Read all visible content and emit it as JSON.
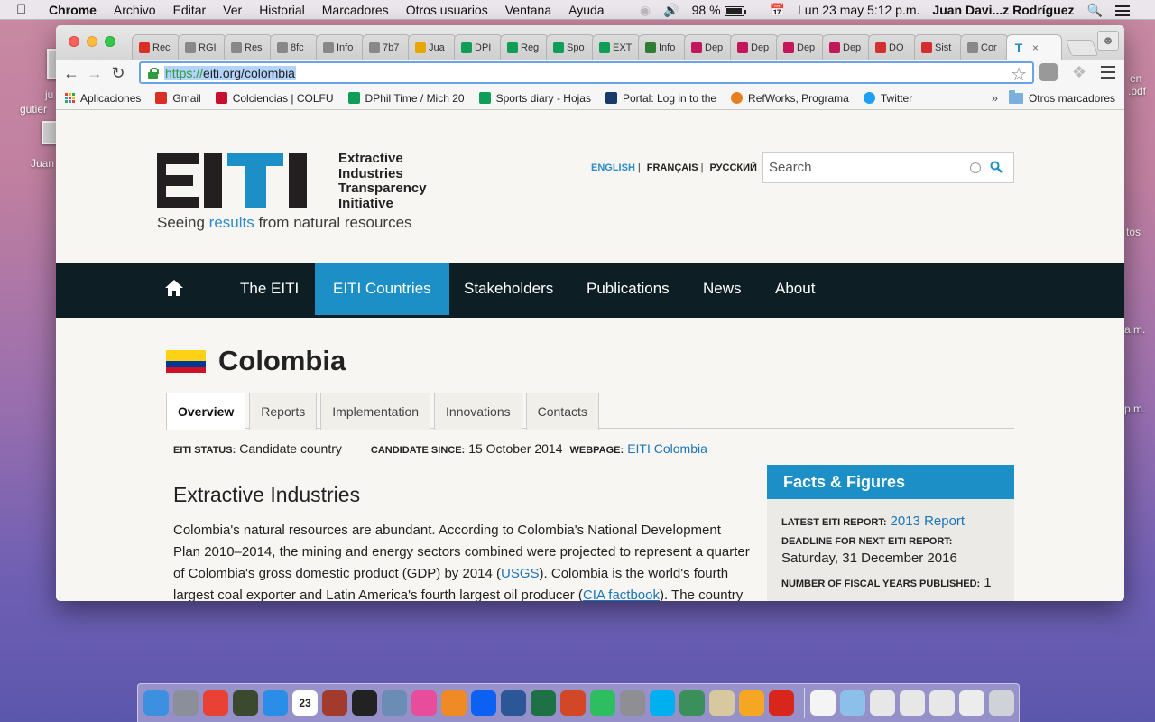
{
  "menubar": {
    "app": "Chrome",
    "items": [
      "Archivo",
      "Editar",
      "Ver",
      "Historial",
      "Marcadores",
      "Otros usuarios",
      "Ventana",
      "Ayuda"
    ],
    "battery": "98 %",
    "datetime": "Lun 23 may  5:12 p.m.",
    "user": "Juan Davi...z Rodríguez"
  },
  "desktop": {
    "labels": [
      "ju",
      "gutier",
      "Juan",
      "en",
      ".pdf",
      "tos",
      "a.m.",
      "p.m."
    ]
  },
  "browser": {
    "tabs": [
      {
        "label": "Rec",
        "icon": "gmail-icon",
        "color": "#d93025"
      },
      {
        "label": "RGI",
        "icon": "doc-icon",
        "color": "#888888"
      },
      {
        "label": "Res",
        "icon": "doc-icon",
        "color": "#888888"
      },
      {
        "label": "8fc",
        "icon": "doc-icon",
        "color": "#888888"
      },
      {
        "label": "Info",
        "icon": "doc-icon",
        "color": "#888888"
      },
      {
        "label": "7b7",
        "icon": "doc-icon",
        "color": "#888888"
      },
      {
        "label": "Jua",
        "icon": "outlook-icon",
        "color": "#e8a700"
      },
      {
        "label": "DPI",
        "icon": "sheets-icon",
        "color": "#0f9d58"
      },
      {
        "label": "Reg",
        "icon": "sheets-icon",
        "color": "#0f9d58"
      },
      {
        "label": "Spo",
        "icon": "sheets-icon",
        "color": "#0f9d58"
      },
      {
        "label": "EXT",
        "icon": "sheets-icon",
        "color": "#0f9d58"
      },
      {
        "label": "Info",
        "icon": "tree-icon",
        "color": "#2e7d32"
      },
      {
        "label": "Dep",
        "icon": "bank-icon",
        "color": "#c2185b"
      },
      {
        "label": "Dep",
        "icon": "bank-icon",
        "color": "#c2185b"
      },
      {
        "label": "Dep",
        "icon": "bank-icon",
        "color": "#c2185b"
      },
      {
        "label": "Dep",
        "icon": "bank-icon",
        "color": "#c2185b"
      },
      {
        "label": "DO",
        "icon": "red-dot-icon",
        "color": "#d32f2f"
      },
      {
        "label": "Sist",
        "icon": "red-dot-icon",
        "color": "#d32f2f"
      },
      {
        "label": "Cor",
        "icon": "doc-icon",
        "color": "#888888"
      }
    ],
    "active_tab": {
      "label": "T",
      "icon": "eiti-icon",
      "color": "#1b8fc6"
    },
    "url_scheme": "https://",
    "url_rest": "eiti.org/colombia",
    "bookmarks": [
      {
        "label": "Aplicaciones",
        "icon": "apps-icon"
      },
      {
        "label": "Gmail",
        "icon": "gmail-icon",
        "color": "#d93025"
      },
      {
        "label": "Colciencias | COLFU",
        "icon": "colciencias-icon",
        "color": "#c8102e"
      },
      {
        "label": "DPhil Time / Mich 20",
        "icon": "sheets-icon",
        "color": "#0f9d58"
      },
      {
        "label": "Sports diary - Hojas",
        "icon": "sheets-icon",
        "color": "#0f9d58"
      },
      {
        "label": "Portal: Log in to the",
        "icon": "portal-icon",
        "color": "#1a3a6b"
      },
      {
        "label": "RefWorks, Programa",
        "icon": "refworks-icon",
        "color": "#e67e22"
      },
      {
        "label": "Twitter",
        "icon": "twitter-icon",
        "color": "#1da1f2"
      }
    ],
    "bookmarks_more": "»",
    "other_bookmarks": "Otros marcadores"
  },
  "site": {
    "logo_letters": "EITI",
    "logo_words": [
      "Extractive",
      "Industries",
      "Transparency",
      "Initiative"
    ],
    "tagline_before": "Seeing ",
    "tagline_accent": "results",
    "tagline_after": " from natural resources",
    "languages": [
      "ENGLISH",
      "FRANÇAIS",
      "РУССКИЙ"
    ],
    "search_placeholder": "Search",
    "nav": [
      "The EITI",
      "EITI Countries",
      "Stakeholders",
      "Publications",
      "News",
      "About"
    ],
    "colors": {
      "accent": "#1b8fc6",
      "nav_bg": "#0d1e24",
      "logo_blue": "#1b8fc6"
    }
  },
  "country": {
    "name": "Colombia",
    "tabs": [
      "Overview",
      "Reports",
      "Implementation",
      "Innovations",
      "Contacts"
    ],
    "status_label": "EITI STATUS:",
    "status_value": "Candidate country",
    "since_label": "CANDIDATE SINCE:",
    "since_value": "15 October 2014",
    "webpage_label": "WEBPAGE:",
    "webpage_value": "EITI Colombia",
    "section_title": "Extractive Industries",
    "para_1": "Colombia's natural resources are abundant. According to Colombia's National Development Plan 2010–2014, the mining and energy sectors combined were projected to represent a quarter of Colombia's gross domestic product (GDP) by 2014 (",
    "link_usgs": "USGS",
    "para_2": "). Colombia is the world's fourth largest coal exporter and Latin America's fourth largest oil producer (",
    "link_cia": "CIA factbook",
    "para_3": "). The country"
  },
  "facts": {
    "title": "Facts & Figures",
    "latest_label": "LATEST EITI REPORT:",
    "latest_value": "2013 Report",
    "deadline_label": "DEADLINE FOR NEXT EITI REPORT:",
    "deadline_value": "Saturday, 31 December 2016",
    "years_label": "NUMBER OF FISCAL YEARS PUBLISHED:",
    "years_value": "1"
  },
  "dock": {
    "apps": [
      "finder-icon",
      "launchpad-icon",
      "chrome-icon",
      "mission-control-icon",
      "safari-icon",
      "calendar-icon",
      "dictionary-icon",
      "gauge-icon",
      "preview-icon",
      "itunes-icon",
      "ibooks-icon",
      "dropbox-icon",
      "word-icon",
      "excel-icon",
      "powerpoint-icon",
      "evernote-icon",
      "system-preferences-icon",
      "skype-icon",
      "globe-icon",
      "photos-preview-icon",
      "photos-icon",
      "acrobat-icon"
    ],
    "docs": [
      "document-icon",
      "applications-folder-icon",
      "pdf-stack-icon",
      "pdf-stack-icon",
      "pdf-stack-icon",
      "mail-icon",
      "trash-icon"
    ],
    "calendar_day": "23"
  }
}
